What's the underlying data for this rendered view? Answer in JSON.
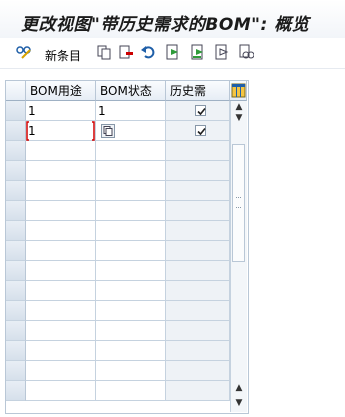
{
  "window": {
    "title": "更改视图\"带历史需求的BOM\": 概览"
  },
  "toolbar": {
    "items": [
      {
        "name": "edit-glasses-icon"
      },
      {
        "label": "新条目"
      },
      {
        "name": "copy-icon"
      },
      {
        "name": "delete-icon"
      },
      {
        "name": "undo-icon"
      },
      {
        "name": "select-all-icon"
      },
      {
        "name": "select-block-icon"
      },
      {
        "name": "deselect-all-icon"
      },
      {
        "name": "other-view-icon"
      }
    ]
  },
  "grid": {
    "columns": [
      "BOM用途",
      "BOM状态",
      "历史需"
    ],
    "rows": [
      {
        "usage": "1",
        "status": "1",
        "history": true
      },
      {
        "usage": "1",
        "status": "",
        "history": true
      }
    ],
    "empty_rows": 13
  },
  "colors": {
    "accent": "#0a6ed1",
    "focus": "#d10000",
    "header_bg": "#e6edf5"
  }
}
